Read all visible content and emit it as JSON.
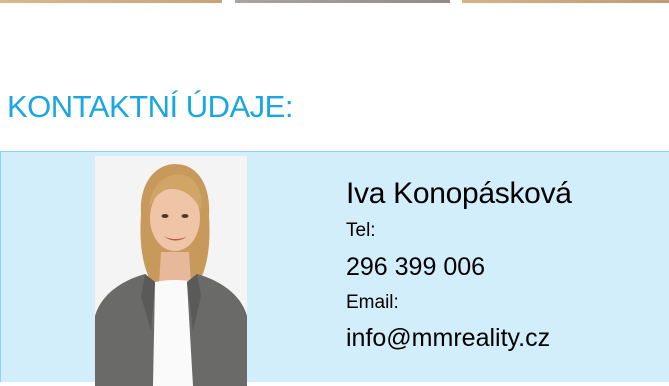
{
  "gallery": {
    "thumbnails": [
      "photo-thumbnail",
      "photo-thumbnail",
      "photo-thumbnail"
    ]
  },
  "contacts": {
    "heading": "KONTAKTNÍ ÚDAJE:",
    "agent": {
      "name": "Iva Konopásková",
      "tel_label": "Tel:",
      "tel_value": "296 399 006",
      "email_label": "Email:",
      "email_value": "info@mmreality.cz",
      "photo_icon": "agent-portrait"
    }
  },
  "colors": {
    "heading": "#1aa6e0",
    "card_background": "#d2eefb",
    "card_border": "#8ed4f2"
  }
}
